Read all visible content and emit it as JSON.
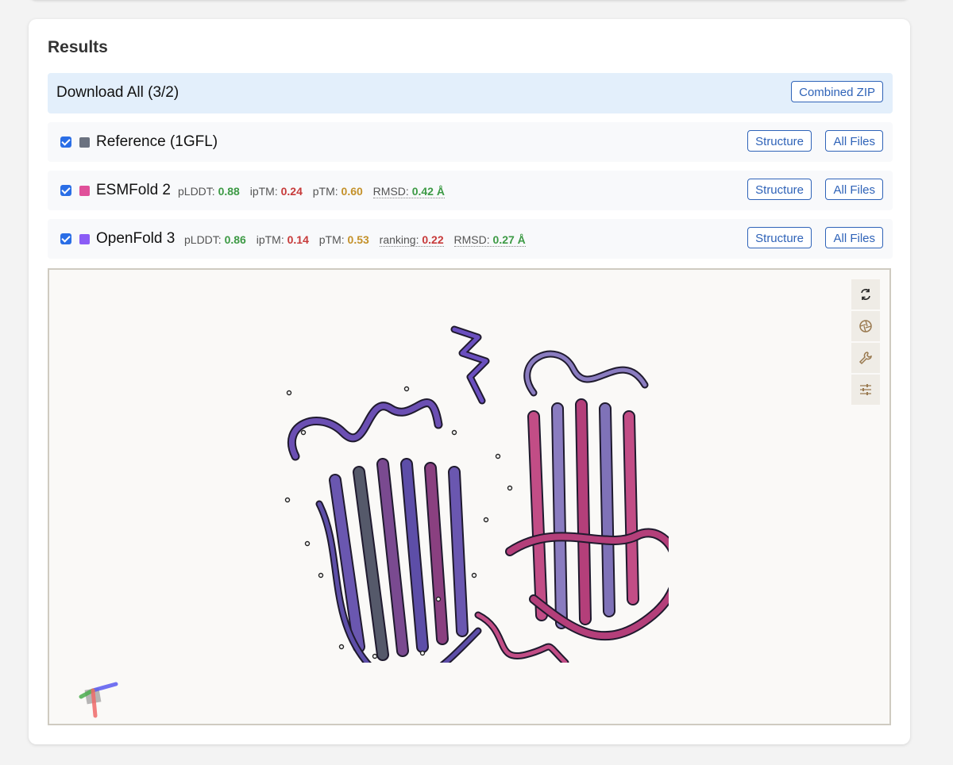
{
  "results": {
    "title": "Results",
    "download_all": {
      "label": "Download All (3/2)",
      "combined_zip_label": "Combined ZIP"
    },
    "structures": [
      {
        "name": "Reference (1GFL)",
        "color": "#6b7280",
        "checked": true,
        "structure_label": "Structure",
        "all_files_label": "All Files",
        "metrics": []
      },
      {
        "name": "ESMFold 2",
        "color": "#e0509a",
        "checked": true,
        "structure_label": "Structure",
        "all_files_label": "All Files",
        "metrics": [
          {
            "label": "pLDDT:",
            "value": "0.88",
            "color": "#3d9a45"
          },
          {
            "label": "ipTM:",
            "value": "0.24",
            "color": "#c73a3a"
          },
          {
            "label": "pTM:",
            "value": "0.60",
            "color": "#c4912a"
          },
          {
            "label": "RMSD:",
            "value": "0.42 Å",
            "color": "#3d9a45"
          }
        ]
      },
      {
        "name": "OpenFold 3",
        "color": "#8b5cf6",
        "checked": true,
        "structure_label": "Structure",
        "all_files_label": "All Files",
        "metrics": [
          {
            "label": "pLDDT:",
            "value": "0.86",
            "color": "#3d9a45"
          },
          {
            "label": "ipTM:",
            "value": "0.14",
            "color": "#c73a3a"
          },
          {
            "label": "pTM:",
            "value": "0.53",
            "color": "#c4912a"
          },
          {
            "label": "ranking:",
            "value": "0.22",
            "color": "#c73a3a"
          },
          {
            "label": "RMSD:",
            "value": "0.27 Å",
            "color": "#3d9a45"
          }
        ]
      }
    ],
    "viewer": {
      "tools": [
        "spin-icon",
        "snapshot-icon",
        "wrench-icon",
        "settings-sliders-icon"
      ]
    }
  }
}
